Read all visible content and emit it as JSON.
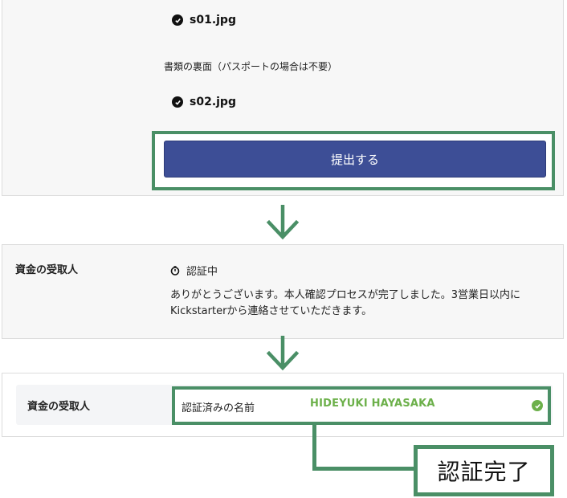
{
  "upload": {
    "file1": "s01.jpg",
    "back_label": "書類の裏面（パスポートの場合は不要）",
    "file2": "s02.jpg",
    "submit_label": "提出する"
  },
  "pending": {
    "title": "資金の受取人",
    "status": "認証中",
    "message": "ありがとうございます。本人確認プロセスが完了しました。3営業日以内にKickstarterから連絡させていただきます。"
  },
  "verified": {
    "title": "資金の受取人",
    "label": "認証済みの名前",
    "name": "HIDEYUKI HAYASAKA"
  },
  "callout": {
    "text": "認証完了"
  },
  "colors": {
    "accent_green": "#4a8f66",
    "button_blue": "#3d4e96",
    "verified_green": "#6cb04a"
  }
}
